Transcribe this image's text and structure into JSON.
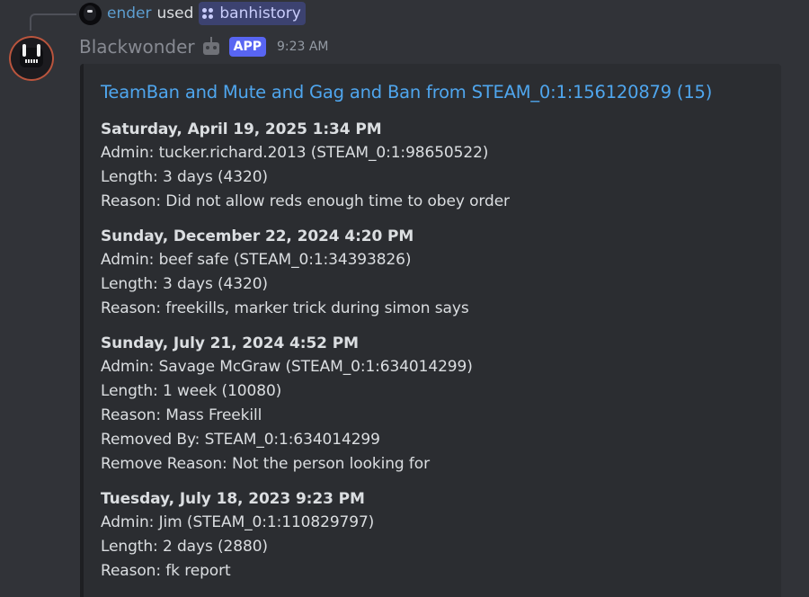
{
  "reply": {
    "user": "ender",
    "used": "used",
    "command": "banhistory"
  },
  "message": {
    "author": "Blackwonder",
    "badge": "APP",
    "time": "9:23 AM"
  },
  "embed": {
    "title": "TeamBan and Mute and Gag and Ban from STEAM_0:1:156120879 (15)",
    "entries": [
      {
        "date": "Saturday, April 19, 2025 1:34 PM",
        "lines": [
          "Admin: tucker.richard.2013 (STEAM_0:1:98650522)",
          "Length: 3 days (4320)",
          "Reason: Did not allow reds enough time to obey order"
        ]
      },
      {
        "date": "Sunday, December 22, 2024 4:20 PM",
        "lines": [
          "Admin: beef safe (STEAM_0:1:34393826)",
          "Length: 3 days (4320)",
          "Reason: freekills, marker trick during simon says"
        ]
      },
      {
        "date": "Sunday, July 21, 2024 4:52 PM",
        "lines": [
          "Admin: Savage McGraw (STEAM_0:1:634014299)",
          "Length: 1 week (10080)",
          "Reason: Mass Freekill",
          "Removed By: STEAM_0:1:634014299",
          "Remove Reason: Not the person looking for"
        ]
      },
      {
        "date": "Tuesday, July 18, 2023 9:23 PM",
        "lines": [
          "Admin: Jim (STEAM_0:1:110829797)",
          "Length: 2 days (2880)",
          "Reason: fk report"
        ]
      }
    ]
  },
  "colors": {
    "background": "#313338",
    "embed_background": "#2b2d31",
    "link": "#4fa6ee",
    "app_badge": "#5865f2",
    "command_chip": "#3c4270"
  },
  "icons": {
    "command": "slash-command-icon",
    "bot": "robot-emoji-icon"
  }
}
